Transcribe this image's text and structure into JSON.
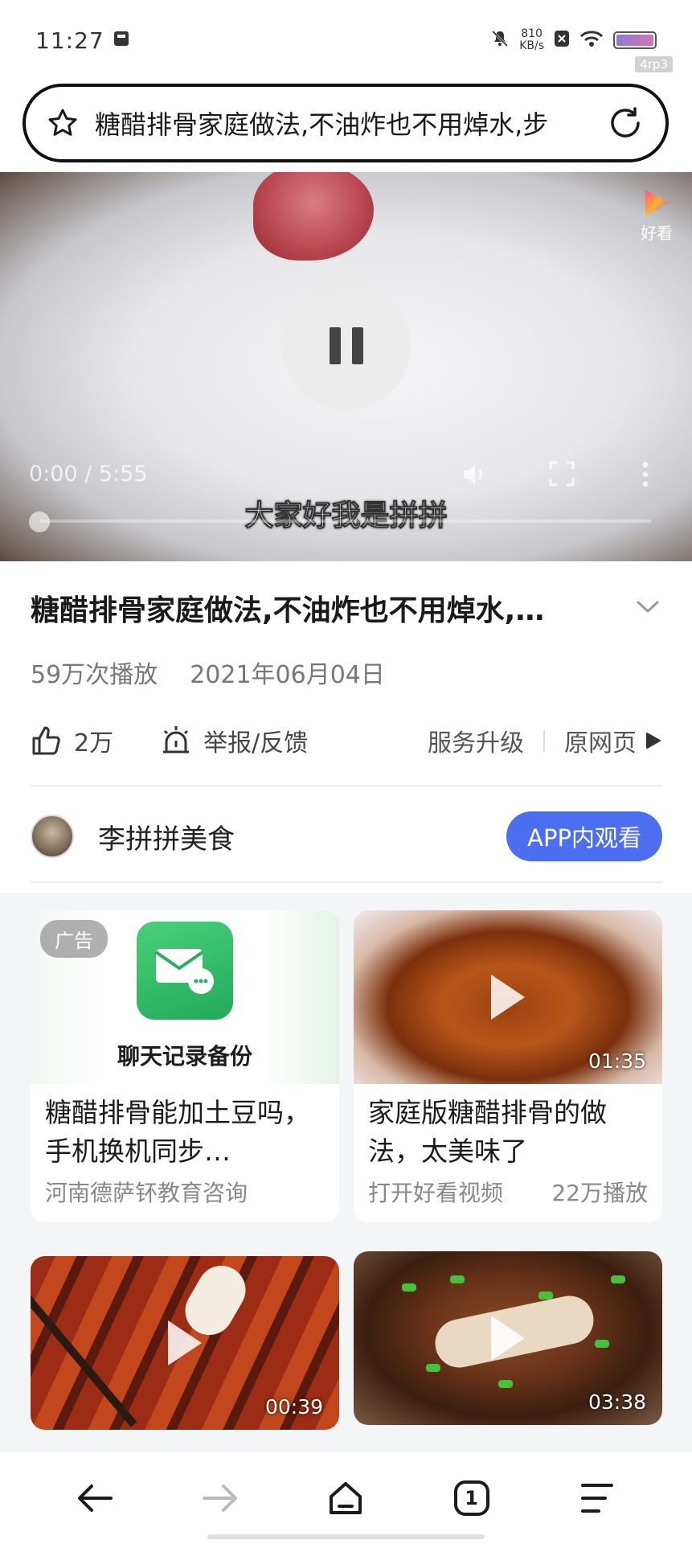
{
  "status_bar": {
    "time": "11:27",
    "net_speed_value": "810",
    "net_speed_unit": "KB/s",
    "watermark": "4rp3"
  },
  "address_bar": {
    "url_text": "糖醋排骨家庭做法,不油炸也不用焯水,步"
  },
  "video": {
    "brand_label": "好看",
    "time": "0:00 / 5:55",
    "subtitle": "大家好我是拼拼",
    "progress": 0.0
  },
  "info": {
    "title": "糖醋排骨家庭做法,不油炸也不用焯水,…",
    "views": "59万次播放",
    "date": "2021年06月04日",
    "like_count": "2万",
    "report_label": "举报/反馈",
    "upgrade_label": "服务升级",
    "source_label": "原网页"
  },
  "author": {
    "name": "李拼拼美食",
    "app_button": "APP内观看"
  },
  "feed": {
    "cards": [
      {
        "badge": "广告",
        "ad_caption": "聊天记录备份",
        "title": "糖醋排骨能加土豆吗，手机换机同步…",
        "sub_left": "河南德萨钚教育咨询",
        "sub_right": ""
      },
      {
        "duration": "01:35",
        "title": "家庭版糖醋排骨的做法，太美味了",
        "sub_left": "打开好看视频",
        "sub_right": "22万播放"
      },
      {
        "duration": "00:39",
        "title": "",
        "sub_left": "",
        "sub_right": ""
      },
      {
        "duration": "03:38",
        "title": "",
        "sub_left": "",
        "sub_right": ""
      }
    ]
  },
  "bottom_nav": {
    "tab_count": "1"
  },
  "colors": {
    "accent": "#4c6ef0",
    "wechat_green": "#21aa5a"
  }
}
